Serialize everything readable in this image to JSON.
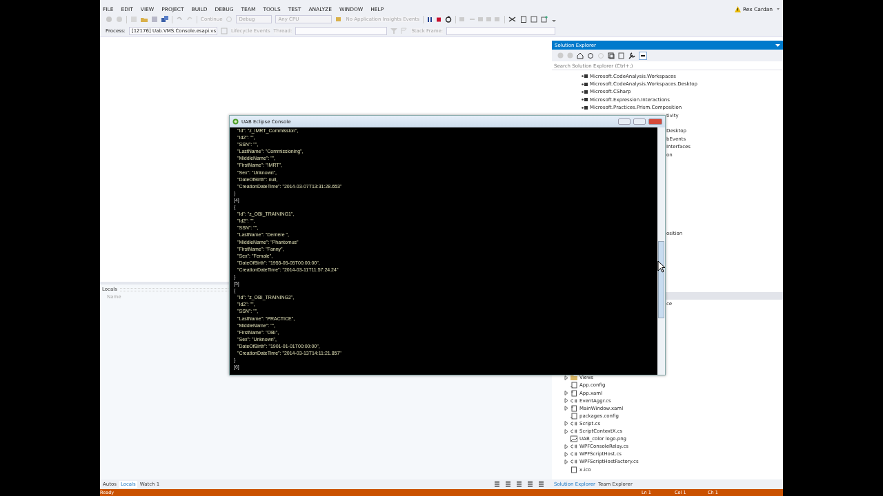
{
  "menu": [
    "FILE",
    "EDIT",
    "VIEW",
    "PROJECT",
    "BUILD",
    "DEBUG",
    "TEAM",
    "TOOLS",
    "TEST",
    "ANALYZE",
    "WINDOW",
    "HELP"
  ],
  "account": {
    "user": "Rex Cardan"
  },
  "toolbar": {
    "continue": {
      "label": "Continue",
      "disabled": true
    },
    "configuration": {
      "value": "Debug",
      "disabled": true
    },
    "platform": {
      "value": "Any CPU",
      "disabled": true
    },
    "insights": {
      "label": "No Application Insights Events",
      "disabled": true
    }
  },
  "debug_location": {
    "process_label": "Process:",
    "process": "[12176] Uab.VMS.Console.esapi.vs",
    "lifecycle": "Lifecycle Events",
    "thread_label": "Thread:",
    "stack_frame_label": "Stack Frame:"
  },
  "locals": {
    "title": "Locals",
    "column": "Name"
  },
  "bottom_tabs": [
    {
      "label": "Autos",
      "selected": false
    },
    {
      "label": "Locals",
      "selected": true
    },
    {
      "label": "Watch 1",
      "selected": false
    }
  ],
  "solution_explorer": {
    "title": "Solution Explorer",
    "search": {
      "placeholder": "Search Solution Explorer (Ctrl+;)"
    },
    "references": [
      "Microsoft.CodeAnalysis.Workspaces",
      "Microsoft.CodeAnalysis.Workspaces.Desktop",
      "Microsoft.CSharp",
      "Microsoft.Expression.Interactions",
      "Microsoft.Practices.Prism.Composition"
    ],
    "partly_hidden": [
      "tivity",
      "Desktop",
      "bEvents",
      "Interfaces",
      "on",
      "osition",
      "ce"
    ],
    "files": [
      {
        "name": "Views",
        "kind": "folder",
        "expandable": true
      },
      {
        "name": "App.config",
        "kind": "config",
        "expandable": false
      },
      {
        "name": "App.xaml",
        "kind": "xaml",
        "expandable": true
      },
      {
        "name": "EventAggr.cs",
        "kind": "cs",
        "expandable": true
      },
      {
        "name": "MainWindow.xaml",
        "kind": "xaml",
        "expandable": true
      },
      {
        "name": "packages.config",
        "kind": "config",
        "expandable": false
      },
      {
        "name": "Script.cs",
        "kind": "cs",
        "expandable": true
      },
      {
        "name": "ScriptContextX.cs",
        "kind": "cs",
        "expandable": true
      },
      {
        "name": "UAB_color logo.png",
        "kind": "image",
        "expandable": false
      },
      {
        "name": "WPFConsoleRelay.cs",
        "kind": "cs",
        "expandable": true
      },
      {
        "name": "WPFScriptHost.cs",
        "kind": "cs",
        "expandable": true
      },
      {
        "name": "WPFScriptHostFactory.cs",
        "kind": "cs",
        "expandable": true
      },
      {
        "name": "x.ico",
        "kind": "file",
        "expandable": false
      }
    ],
    "tabs": [
      {
        "label": "Solution Explorer",
        "selected": true
      },
      {
        "label": "Team Explorer",
        "selected": false
      }
    ]
  },
  "status_bar": {
    "message": "Ready",
    "line": "Ln 1",
    "column": "Col 1",
    "char": "Ch 1"
  },
  "console": {
    "title": "UAB Eclipse Console",
    "lines": [
      {
        "text": "\"Id\": \"z_IMRT_Commission\",",
        "kind": "field"
      },
      {
        "text": "\"Id2\": \"\",",
        "kind": "field"
      },
      {
        "text": "\"SSN\": \"\",",
        "kind": "field"
      },
      {
        "text": "\"LastName\": \"Commissioning\",",
        "kind": "field"
      },
      {
        "text": "\"MiddleName\": \"\",",
        "kind": "field"
      },
      {
        "text": "\"FirstName\": \"IMRT\",",
        "kind": "field"
      },
      {
        "text": "\"Sex\": \"Unknown\",",
        "kind": "field"
      },
      {
        "text": "\"DateOfBirth\": null,",
        "kind": "field"
      },
      {
        "text": "\"CreationDateTime\": \"2014-03-07T13:31:28.653\"",
        "kind": "field"
      },
      {
        "text": "}",
        "kind": "bracket"
      },
      {
        "text": "[4]",
        "kind": "bracket"
      },
      {
        "text": "{",
        "kind": "bracket"
      },
      {
        "text": "\"Id\": \"z_OBI_TRAINING1\",",
        "kind": "field"
      },
      {
        "text": "\"Id2\": \"\",",
        "kind": "field"
      },
      {
        "text": "\"SSN\": \"\",",
        "kind": "field"
      },
      {
        "text": "\"LastName\": \"Derrière \",",
        "kind": "field"
      },
      {
        "text": "\"MiddleName\": \"Phantomus\"",
        "kind": "field"
      },
      {
        "text": "\"FirstName\": \"Fanny\",",
        "kind": "field"
      },
      {
        "text": "\"Sex\": \"Female\",",
        "kind": "field"
      },
      {
        "text": "\"DateOfBirth\": \"1955-05-05T00:00:00\",",
        "kind": "field"
      },
      {
        "text": "\"CreationDateTime\": \"2014-03-11T11:57:24.24\"",
        "kind": "field"
      },
      {
        "text": "}",
        "kind": "bracket"
      },
      {
        "text": "[5]",
        "kind": "bracket"
      },
      {
        "text": "{",
        "kind": "bracket"
      },
      {
        "text": "\"Id\": \"z_OBI_TRAINING2\",",
        "kind": "field"
      },
      {
        "text": "\"Id2\": \"\",",
        "kind": "field"
      },
      {
        "text": "\"SSN\": \"\",",
        "kind": "field"
      },
      {
        "text": "\"LastName\": \"PRACTICE\",",
        "kind": "field"
      },
      {
        "text": "\"MiddleName\": \"\",",
        "kind": "field"
      },
      {
        "text": "\"FirstName\": \"OBI\",",
        "kind": "field"
      },
      {
        "text": "\"Sex\": \"Unknown\",",
        "kind": "field"
      },
      {
        "text": "\"DateOfBirth\": \"1901-01-01T00:00:00\",",
        "kind": "field"
      },
      {
        "text": "\"CreationDateTime\": \"2014-03-13T14:11:21.857\"",
        "kind": "field"
      },
      {
        "text": "}",
        "kind": "bracket"
      },
      {
        "text": "[6]",
        "kind": "bracket"
      }
    ]
  }
}
